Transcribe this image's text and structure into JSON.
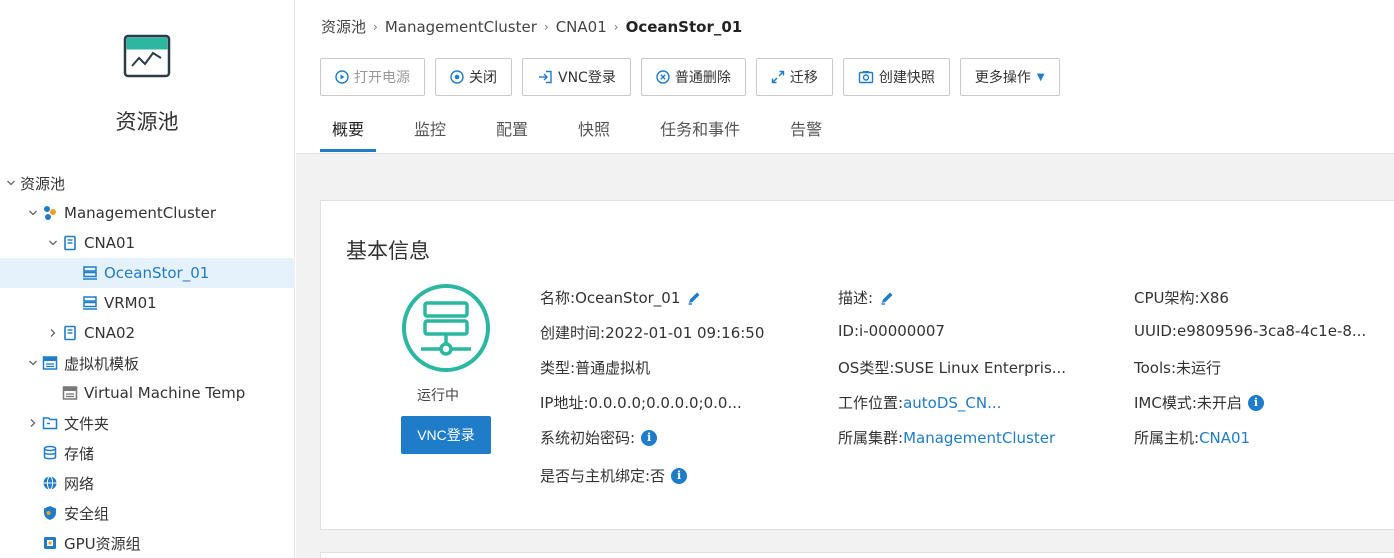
{
  "sidebar": {
    "title": "资源池",
    "tree": [
      {
        "label": "资源池",
        "icon": "none",
        "caret": "down",
        "indent": 0
      },
      {
        "label": "ManagementCluster",
        "icon": "cluster-icon",
        "caret": "down",
        "indent": 1
      },
      {
        "label": "CNA01",
        "icon": "host-icon",
        "caret": "down",
        "indent": 2
      },
      {
        "label": "OceanStor_01",
        "icon": "vm-icon",
        "caret": "none",
        "indent": 3,
        "selected": true
      },
      {
        "label": "VRM01",
        "icon": "vm-icon",
        "caret": "none",
        "indent": 3
      },
      {
        "label": "CNA02",
        "icon": "host-icon",
        "caret": "right",
        "indent": 2
      },
      {
        "label": "虚拟机模板",
        "icon": "template-icon",
        "caret": "down",
        "indent": 1
      },
      {
        "label": "Virtual Machine Temp",
        "icon": "template-gray-icon",
        "caret": "none",
        "indent": 2
      },
      {
        "label": "文件夹",
        "icon": "folder-icon",
        "caret": "right",
        "indent": 1
      },
      {
        "label": "存储",
        "icon": "storage-icon",
        "caret": "none",
        "indent": 1
      },
      {
        "label": "网络",
        "icon": "network-icon",
        "caret": "none",
        "indent": 1
      },
      {
        "label": "安全组",
        "icon": "security-group-icon",
        "caret": "none",
        "indent": 1
      },
      {
        "label": "GPU资源组",
        "icon": "gpu-icon",
        "caret": "none",
        "indent": 1
      }
    ]
  },
  "breadcrumb": [
    "资源池",
    "ManagementCluster",
    "CNA01",
    "OceanStor_01"
  ],
  "toolbar": [
    {
      "label": "打开电源",
      "icon": "power-on-icon",
      "disabled": true
    },
    {
      "label": "关闭",
      "icon": "shutdown-icon",
      "disabled": false
    },
    {
      "label": "VNC登录",
      "icon": "login-icon",
      "disabled": false
    },
    {
      "label": "普通删除",
      "icon": "delete-icon",
      "disabled": false
    },
    {
      "label": "迁移",
      "icon": "migrate-icon",
      "disabled": false
    },
    {
      "label": "创建快照",
      "icon": "snapshot-icon",
      "disabled": false
    },
    {
      "label": "更多操作",
      "icon": "none",
      "disabled": false,
      "dropdown": true
    }
  ],
  "tabs": [
    {
      "label": "概要",
      "active": true
    },
    {
      "label": "监控"
    },
    {
      "label": "配置"
    },
    {
      "label": "快照"
    },
    {
      "label": "任务和事件"
    },
    {
      "label": "告警"
    }
  ],
  "basic_info": {
    "title": "基本信息",
    "status": "运行中",
    "vnc_button": "VNC登录",
    "col1": [
      {
        "key": "名称: ",
        "value": "OceanStor_01",
        "edit": true
      },
      {
        "key": "创建时间: ",
        "value": "2022-01-01 09:16:50"
      },
      {
        "key": "类型: ",
        "value": "普通虚拟机"
      },
      {
        "key": "IP地址: ",
        "value": "0.0.0.0;0.0.0.0;0.0..."
      },
      {
        "key": "系统初始密码: ",
        "value": "",
        "info": true
      },
      {
        "key": "是否与主机绑定: ",
        "value": "否",
        "info": true
      }
    ],
    "col2": [
      {
        "key": "描述: ",
        "value": "",
        "edit": true
      },
      {
        "key": "ID: ",
        "value": "i-00000007"
      },
      {
        "key": "OS类型: ",
        "value": "SUSE Linux Enterpris..."
      },
      {
        "key": "工作位置: ",
        "value": "autoDS_CN...",
        "link": true
      },
      {
        "key": "所属集群: ",
        "value": "ManagementCluster",
        "link": true
      }
    ],
    "col3": [
      {
        "key": "CPU架构: ",
        "value": "X86"
      },
      {
        "key": "UUID: ",
        "value": "e9809596-3ca8-4c1e-8..."
      },
      {
        "key": "Tools: ",
        "value": "未运行"
      },
      {
        "key": "IMC模式: ",
        "value": "未开启",
        "info": true
      },
      {
        "key": "所属主机: ",
        "value": "CNA01",
        "link": true
      }
    ]
  },
  "colors": {
    "accent": "#1f7cc9",
    "teal": "#2bb7a0",
    "selected_bg": "#e6f2fb"
  }
}
